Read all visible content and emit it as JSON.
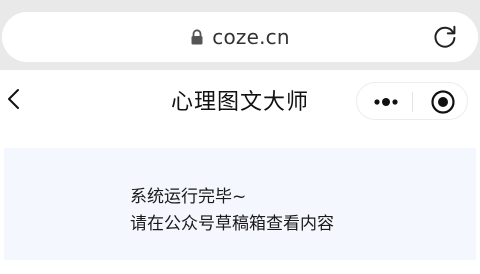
{
  "browser": {
    "url": "coze.cn"
  },
  "header": {
    "title": "心理图文大师"
  },
  "message": {
    "lines": [
      "系统运行完毕~",
      "请在公众号草稿箱查看内容"
    ]
  },
  "colors": {
    "browser_bg": "#e9e9e9",
    "message_bg": "#f4f7fd"
  },
  "icons": {
    "lock": "lock-icon",
    "reload": "reload-icon",
    "back": "chevron-left-icon",
    "more": "more-dots-icon",
    "close": "target-close-icon"
  }
}
